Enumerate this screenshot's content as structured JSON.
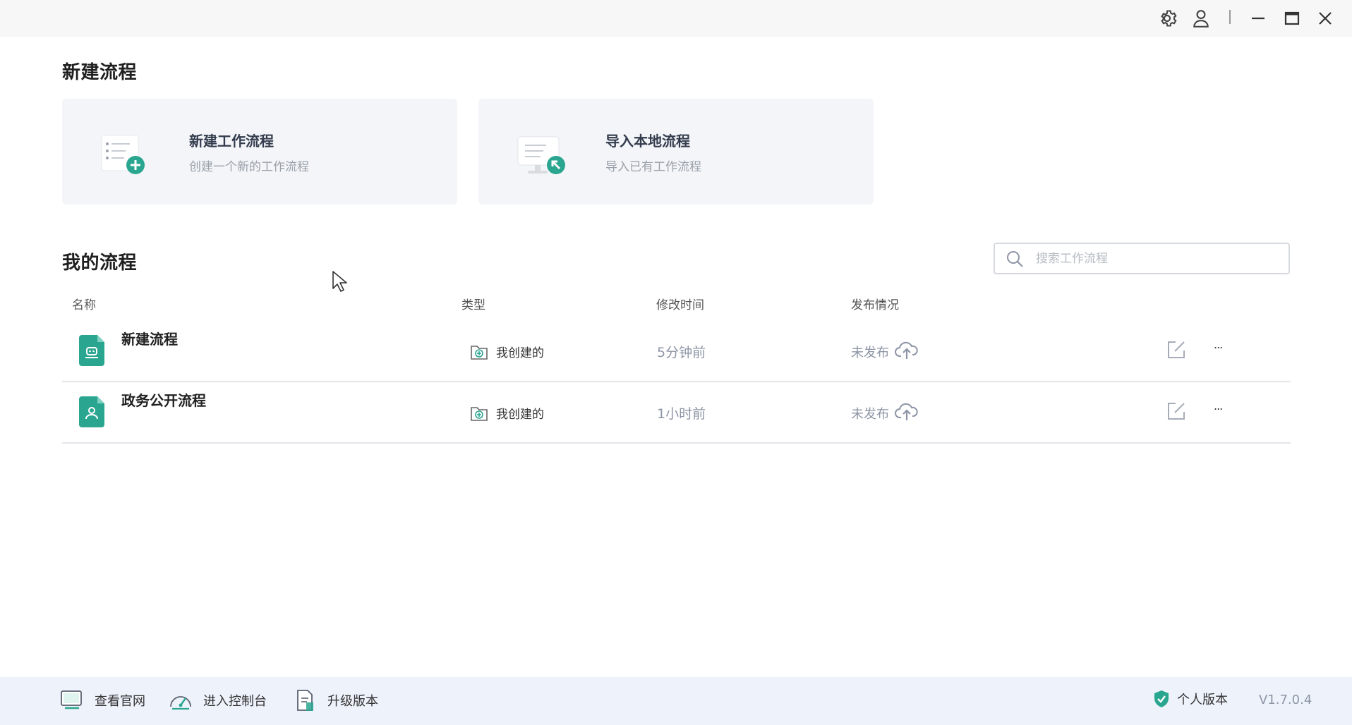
{
  "titlebar": {
    "icons": [
      "gear-icon",
      "user-icon",
      "minimize-icon",
      "maximize-icon",
      "close-icon"
    ]
  },
  "new_section": {
    "title": "新建流程",
    "cards": [
      {
        "title": "新建工作流程",
        "subtitle": "创建一个新的工作流程",
        "icon": "new-workflow-icon"
      },
      {
        "title": "导入本地流程",
        "subtitle": "导入已有工作流程",
        "icon": "import-workflow-icon"
      }
    ]
  },
  "my_section": {
    "title": "我的流程",
    "search": {
      "placeholder": "搜索工作流程",
      "value": ""
    },
    "columns": [
      "名称",
      "类型",
      "修改时间",
      "发布情况"
    ],
    "rows": [
      {
        "name": "新建流程",
        "type": "我创建的",
        "modified": "5分钟前",
        "status": "未发布",
        "more": "..."
      },
      {
        "name": "政务公开流程",
        "type": "我创建的",
        "modified": "1小时前",
        "status": "未发布",
        "more": "..."
      }
    ]
  },
  "footer": {
    "links": [
      {
        "label": "查看官网",
        "icon": "monitor-icon"
      },
      {
        "label": "进入控制台",
        "icon": "dashboard-icon"
      },
      {
        "label": "升级版本",
        "icon": "upgrade-icon"
      }
    ],
    "edition": "个人版本",
    "version": "V1.7.0.4"
  },
  "colors": {
    "accent": "#2aa690",
    "titlebar_bg": "#f7f7f7",
    "card_bg": "#f3f5f8",
    "footer_bg": "#eef2fb",
    "muted_text": "#8d95a5"
  }
}
